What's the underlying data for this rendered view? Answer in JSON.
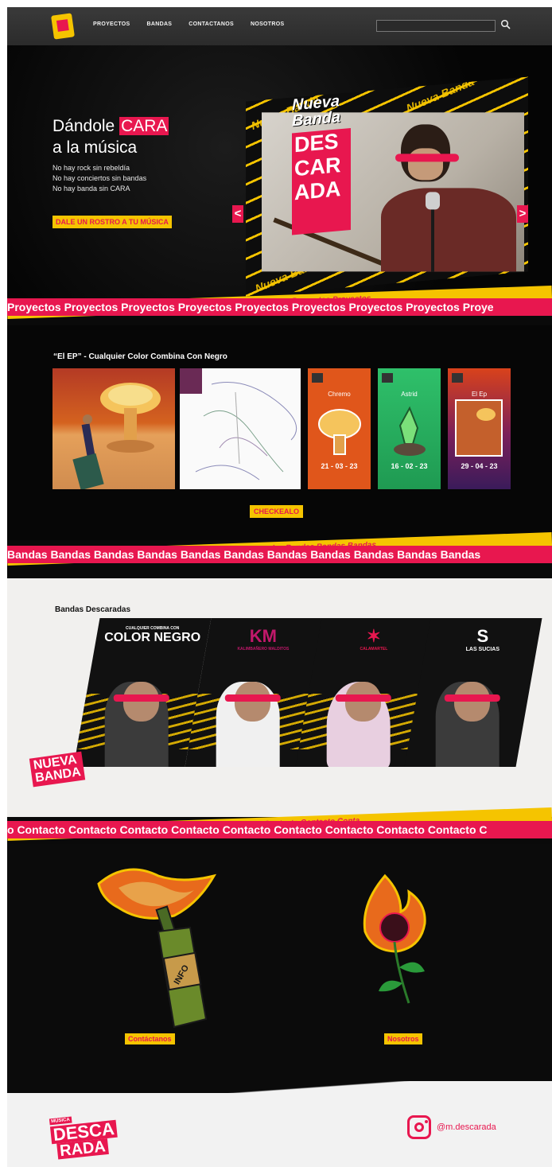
{
  "nav": {
    "links": [
      "PROYECTOS",
      "BANDAS",
      "CONTACTANOS",
      "NOSOTROS"
    ],
    "search_placeholder": ""
  },
  "hero": {
    "title_prefix": "Dándole ",
    "title_highlight": "CARA",
    "title_line2": "a la música",
    "lines": [
      "No hay rock sin rebeldía",
      "No hay conciertos sin bandas",
      "No hay banda sin CARA"
    ],
    "cta": "DALE UN ROSTRO A TU MÚSICA",
    "slide_heading_1": "Nueva",
    "slide_heading_2": "Banda",
    "slide_badge": [
      "DES",
      "CAR",
      "ADA"
    ],
    "stripe_word": "Nueva Banda",
    "prev": "<",
    "next": ">",
    "slide_count": 3,
    "active_slide": 1
  },
  "ticker_proyectos": "Proyectos Proyectos Proyectos Proyectos Proyectos Proyectos Proyectos Proyectos Proye",
  "ticker_proyectos_back": "Proyectos Proyectos Proyectos Proyectos Proyectos Proyectos Proyectos Proyectos Proyectos",
  "proyectos": {
    "title": "“El EP” - Cualquier Color Combina Con Negro",
    "cards": [
      {
        "label": "",
        "date": ""
      },
      {
        "label": "",
        "date": ""
      },
      {
        "label": "Chremo",
        "date": "21 - 03 - 23"
      },
      {
        "label": "Astrid",
        "date": "16 - 02 - 23"
      },
      {
        "label": "El Ep",
        "date": "29 - 04 - 23"
      }
    ],
    "cta": "CHECKEALO"
  },
  "ticker_bandas": "Bandas Bandas Bandas Bandas Bandas Bandas Bandas Bandas Bandas Bandas Bandas",
  "ticker_bandas_back": "Bandas Bandas Bandas Bandas Bandas Bandas Bandas Bandas Bandas Bandas Bandas Bandas",
  "bandas": {
    "title": "Bandas Descaradas",
    "cards": [
      {
        "logo": "COLOR NEGRO",
        "logo_small": "CUALQUIER COMBINA CON"
      },
      {
        "logo": "KM",
        "logo_small": "KALIMBAÑERO MALDITOS"
      },
      {
        "logo": "✶",
        "logo_small": "CALAMARTEL"
      },
      {
        "logo": "S",
        "logo_small": "LAS SUCIAS"
      }
    ],
    "new_tag": [
      "NUEVA",
      "BANDA"
    ]
  },
  "ticker_contacto": "o Contacto Contacto Contacto Contacto Contacto Contacto Contacto Contacto Contacto C",
  "ticker_contacto_back": "Contacto Contacto Contacto Contacto Contacto Contacto Contacto Contacto Contacto Conta",
  "contacto": {
    "bottle_text": "INFO",
    "left_label": "Contáctanos",
    "right_label": "Nosotros"
  },
  "footer": {
    "logo_top": "MÚSICA",
    "logo_mid": "DESCA",
    "logo_bottom": "RADA",
    "instagram": "@m.descarada"
  },
  "colors": {
    "accent": "#e8174f",
    "yellow": "#f5c400",
    "dark": "#0a0a0a",
    "paper": "#f1f0ee"
  }
}
